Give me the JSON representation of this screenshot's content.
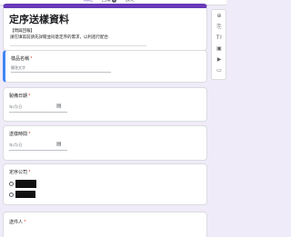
{
  "tabs": [
    {
      "label": "問題"
    },
    {
      "label": "回覆",
      "badge": "5"
    },
    {
      "label": "設定"
    }
  ],
  "form": {
    "title": "定序送樣資料",
    "desc_line1": "【問與回報】",
    "desc_line2": "請在填寫前請先詳閱並同意定序的需求，以利進行配合"
  },
  "questions": [
    {
      "label": "樣品名稱",
      "required": "*",
      "hint": "簡答文字"
    },
    {
      "label": "製備日期",
      "required": "*",
      "hint": "年/月/日"
    },
    {
      "label": "送樣時間",
      "required": "*",
      "hint": "年/月/日"
    },
    {
      "label": "定序公司",
      "required": "*"
    },
    {
      "label": "送件人",
      "required": "*"
    }
  ],
  "sidebar": {
    "icons": [
      "add-question-icon",
      "import-icon",
      "title-text-icon",
      "image-icon",
      "video-icon",
      "section-icon"
    ]
  }
}
